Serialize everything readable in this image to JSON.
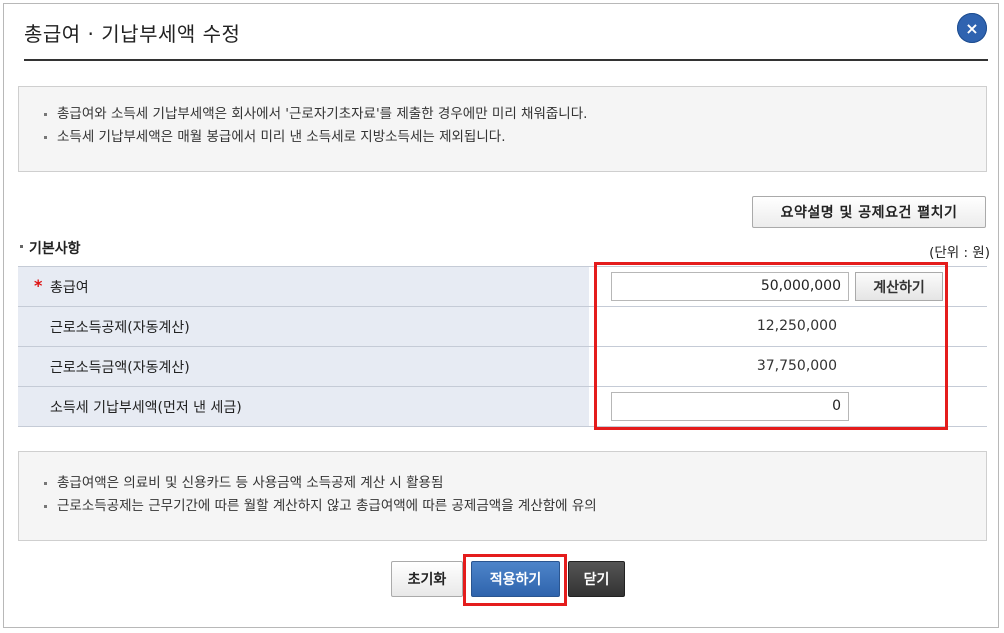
{
  "dialog": {
    "title": "총급여 · 기납부세액 수정",
    "close_icon": "×"
  },
  "notice_top": [
    "총급여와 소득세 기납부세액은 회사에서 '근로자기초자료'를 제출한 경우에만 미리 채워줍니다.",
    "소득세 기납부세액은 매월 봉급에서 미리 낸 소득세로 지방소득세는 제외됩니다."
  ],
  "expand_button": "요약설명 및 공제요건 펼치기",
  "section": {
    "title": "기본사항",
    "unit": "(단위 : 원)"
  },
  "fields": {
    "gross_salary": {
      "required_mark": "*",
      "label": "총급여",
      "value": "50,000,000",
      "calc_button": "계산하기"
    },
    "earned_income_deduction": {
      "label": "근로소득공제(자동계산)",
      "value": "12,250,000"
    },
    "earned_income_amount": {
      "label": "근로소득금액(자동계산)",
      "value": "37,750,000"
    },
    "prepaid_tax": {
      "label": "소득세 기납부세액(먼저 낸 세금)",
      "value": "0"
    }
  },
  "notice_bottom": [
    "총급여액은 의료비 및 신용카드 등 사용금액 소득공제 계산 시 활용됨",
    "근로소득공제는 근무기간에 따른 월할 계산하지 않고 총급여액에 따른 공제금액을 계산함에 유의"
  ],
  "footer": {
    "reset": "초기화",
    "apply": "적용하기",
    "close": "닫기"
  },
  "colors": {
    "accent_blue": "#2f64ad",
    "highlight_red": "#e41c1c",
    "label_bg": "#e7ebf3"
  }
}
